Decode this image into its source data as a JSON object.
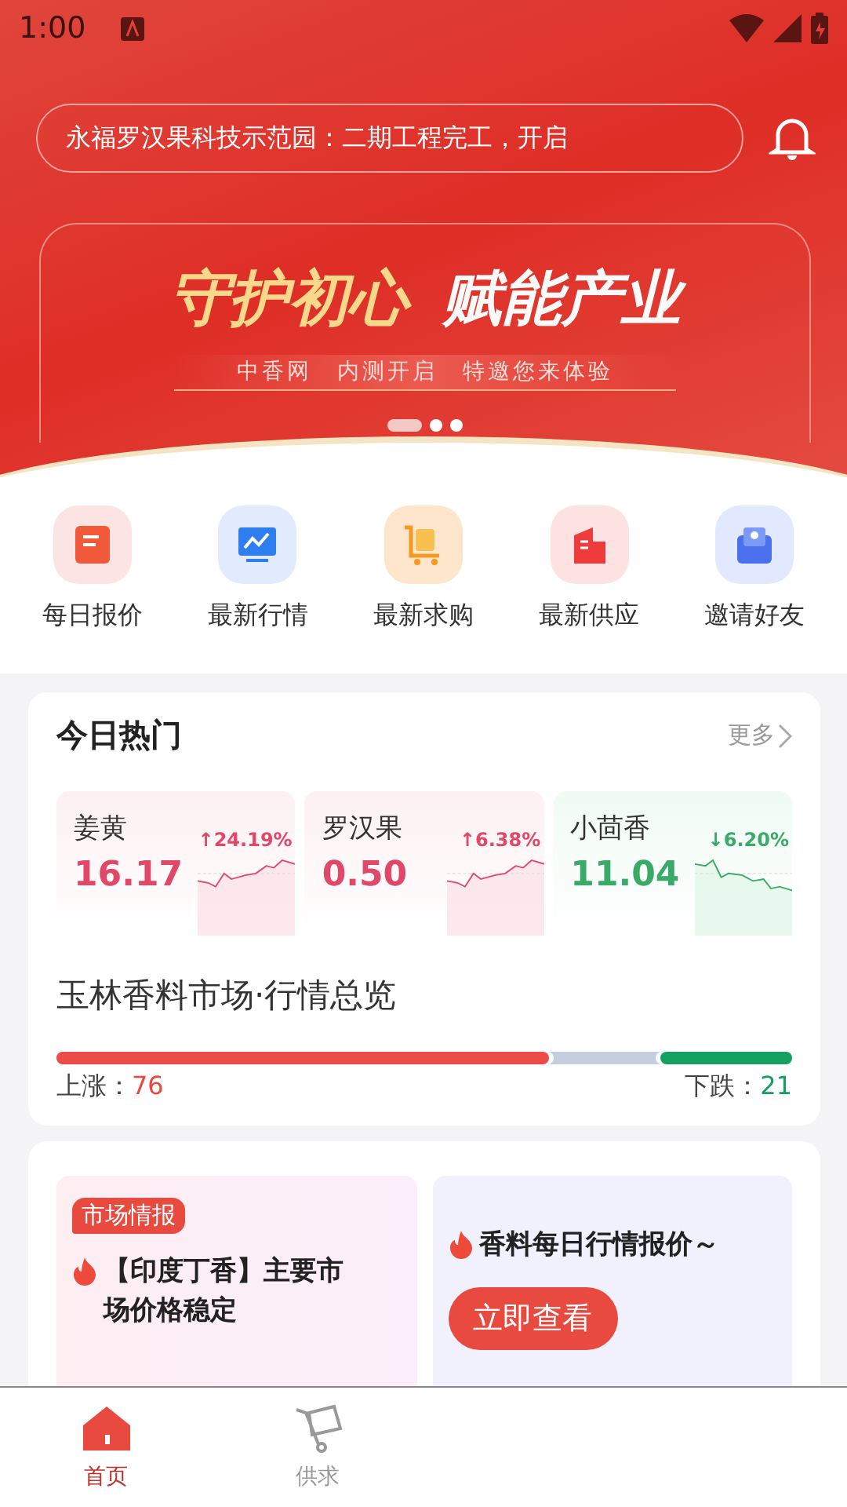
{
  "status_bar": {
    "time": "1:00"
  },
  "notice": {
    "text": "永福罗汉果科技示范园：二期工程完工，开启"
  },
  "banner": {
    "headline_left": "守护初心",
    "headline_right": "赋能产业",
    "subline": "中香网　内测开启　特邀您来体验",
    "dots": [
      {
        "selected": true
      },
      {
        "selected": false
      },
      {
        "selected": false
      }
    ]
  },
  "shortcuts": [
    {
      "label": "每日报价",
      "kind": "quote"
    },
    {
      "label": "最新行情",
      "kind": "market"
    },
    {
      "label": "最新求购",
      "kind": "cart"
    },
    {
      "label": "最新供应",
      "kind": "building"
    },
    {
      "label": "邀请好友",
      "kind": "invite"
    }
  ],
  "hot": {
    "title": "今日热门",
    "more": "更多",
    "items": [
      {
        "name": "姜黄",
        "price": "16.17",
        "change": "↑24.19%",
        "kind": "up"
      },
      {
        "name": "罗汉果",
        "price": "0.50",
        "change": "↑6.38%",
        "kind": "up"
      },
      {
        "name": "小茴香",
        "price": "11.04",
        "change": "↓6.20%",
        "kind": "down"
      }
    ],
    "overview_title": "玉林香料市场·行情总览",
    "overview_bar": {
      "rise": {
        "level": 0.67
      },
      "fall": {
        "level": 0.18
      }
    },
    "rise_label": "上涨：",
    "rise_count": "76",
    "fall_label": "下跌：",
    "fall_count": "21"
  },
  "promo": {
    "tag": "市场情报",
    "left_text": "【印度丁香】主要市场价格稳定",
    "right_text": "香料每日行情报价～",
    "button": "立即查看"
  },
  "tab_bar": [
    {
      "label": "首页",
      "kind": "home",
      "selected": true
    },
    {
      "label": "供求",
      "kind": "trade",
      "selected": false
    }
  ]
}
